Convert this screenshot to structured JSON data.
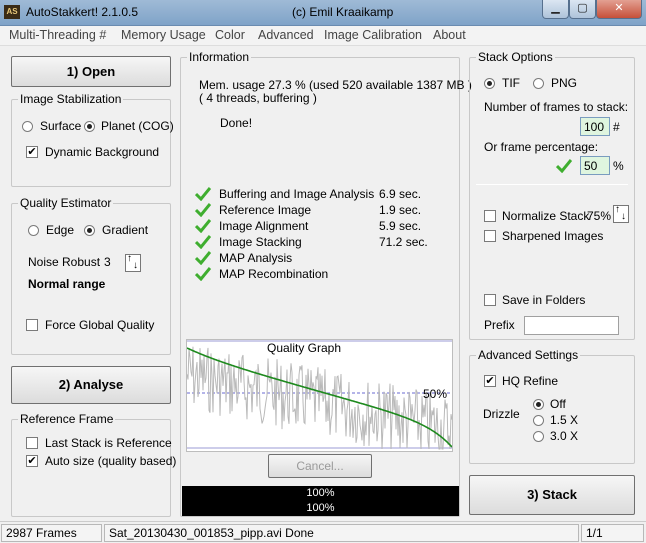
{
  "window": {
    "title": "AutoStakkert! 2.1.0.5",
    "author": "(c) Emil Kraaikamp",
    "icon_text": "AS"
  },
  "menu": [
    "Multi-Threading #",
    "Memory Usage",
    "Color",
    "Advanced",
    "Image Calibration",
    "About"
  ],
  "left": {
    "open_label": "1) Open",
    "stab_title": "Image Stabilization",
    "surface_label": "Surface",
    "planet_label": "Planet (COG)",
    "dyn_bg_label": "Dynamic Background",
    "qe_title": "Quality Estimator",
    "edge_label": "Edge",
    "gradient_label": "Gradient",
    "noise_label": "Noise Robust",
    "noise_value": "3",
    "range_label": "Normal range",
    "force_label": "Force Global Quality",
    "analyse_label": "2) Analyse",
    "ref_title": "Reference Frame",
    "last_stack_label": "Last Stack is Reference",
    "auto_size_label": "Auto size (quality based)"
  },
  "info": {
    "title": "Information",
    "mem_line1": "Mem. usage 27.3 %  (used 520 available 1387 MB )",
    "mem_line2": "( 4 threads, buffering )",
    "done": "Done!",
    "steps": [
      {
        "name": "Buffering and Image Analysis",
        "time": "6.9 sec."
      },
      {
        "name": "Reference Image",
        "time": "1.9 sec."
      },
      {
        "name": "Image Alignment",
        "time": "5.9 sec."
      },
      {
        "name": "Image Stacking",
        "time": "71.2 sec."
      },
      {
        "name": "MAP Analysis",
        "time": ""
      },
      {
        "name": "MAP Recombination",
        "time": ""
      }
    ],
    "graph_title": "Quality Graph",
    "graph_pct": "50%",
    "cancel_label": "Cancel...",
    "progress1": "100%",
    "progress2": "100%"
  },
  "right": {
    "stack_title": "Stack Options",
    "tif_label": "TIF",
    "png_label": "PNG",
    "num_frames_label": "Number of frames to stack:",
    "num_frames_value": "100",
    "hash": "#",
    "frame_pct_label": "Or frame percentage:",
    "frame_pct_value": "50",
    "pct": "%",
    "normalize_label": "Normalize Stack",
    "normalize_value": "75%",
    "sharpened_label": "Sharpened Images",
    "save_folders_label": "Save in Folders",
    "prefix_label": "Prefix",
    "prefix_value": "",
    "adv_title": "Advanced Settings",
    "hq_label": "HQ Refine",
    "drizzle_label": "Drizzle",
    "drizzle_off": "Off",
    "drizzle_15": "1.5 X",
    "drizzle_30": "3.0 X",
    "stack_label": "3) Stack"
  },
  "status": {
    "frames": "2987 Frames",
    "file": "Sat_20130430_001853_pipp.avi   Done",
    "page": "1/1"
  },
  "colors": {
    "tick": "#3fae2f",
    "curve": "#1e8a1e",
    "noise": "#b9b9b9",
    "accent": "#3c7fb1"
  }
}
